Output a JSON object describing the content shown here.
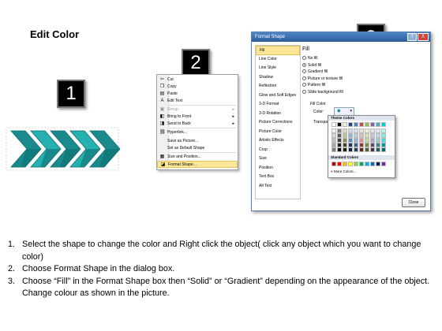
{
  "slide_title": "Edit Color",
  "badges": [
    "1",
    "2",
    "3"
  ],
  "context_menu": {
    "items": [
      {
        "icon": "cut-icon",
        "glyph": "✂",
        "label": "Cut",
        "disabled": false,
        "submenu": false
      },
      {
        "icon": "copy-icon",
        "glyph": "❐",
        "label": "Copy",
        "disabled": false,
        "submenu": false
      },
      {
        "icon": "paste-icon",
        "glyph": "▤",
        "label": "Paste",
        "disabled": false,
        "submenu": false
      },
      {
        "icon": "edit-text-icon",
        "glyph": "A",
        "label": "Edit Text",
        "disabled": false,
        "submenu": false
      },
      {
        "icon": "group-icon",
        "glyph": "▣",
        "label": "Group",
        "disabled": true,
        "submenu": true
      },
      {
        "icon": "bring-front-icon",
        "glyph": "◧",
        "label": "Bring to Front",
        "disabled": false,
        "submenu": true
      },
      {
        "icon": "send-back-icon",
        "glyph": "◨",
        "label": "Send to Back",
        "disabled": false,
        "submenu": true
      },
      {
        "icon": "hyperlink-icon",
        "glyph": "⛓",
        "label": "Hyperlink...",
        "disabled": false,
        "submenu": false
      },
      {
        "icon": "save-picture-icon",
        "glyph": "",
        "label": "Save as Picture...",
        "disabled": false,
        "submenu": false
      },
      {
        "icon": "default-shape-icon",
        "glyph": "",
        "label": "Set as Default Shape",
        "disabled": false,
        "submenu": false
      },
      {
        "icon": "size-position-icon",
        "glyph": "▦",
        "label": "Size and Position...",
        "disabled": false,
        "submenu": false
      },
      {
        "icon": "format-shape-icon",
        "glyph": "◪",
        "label": "Format Shape...",
        "disabled": false,
        "submenu": false,
        "highlight": true
      }
    ]
  },
  "dialog": {
    "title": "Format Shape",
    "help_label": "?",
    "close_x_label": "X",
    "categories": [
      "Fill",
      "Line Color",
      "Line Style",
      "Shadow",
      "Reflection",
      "Glow and Soft Edges",
      "3-D Format",
      "3-D Rotation",
      "Picture Corrections",
      "Picture Color",
      "Artistic Effects",
      "Crop",
      "Size",
      "Position",
      "Text Box",
      "Alt Text"
    ],
    "selected_category": "Fill",
    "fill_heading": "Fill",
    "fill_options": [
      "No fill",
      "Solid fill",
      "Gradient fill",
      "Picture or texture fill",
      "Pattern fill",
      "Slide background fill"
    ],
    "selected_fill": "Solid fill",
    "fill_color_label": "Fill Color",
    "color_label": "Color:",
    "transparency_label": "Transpar",
    "close_button": "Close"
  },
  "palette": {
    "theme_heading": "Theme Colors",
    "standard_heading": "Standard Colors",
    "more_colors": "More Colors...",
    "theme_top": [
      "#ffffff",
      "#000000",
      "#eeece1",
      "#1f497d",
      "#4f81bd",
      "#c0504d",
      "#9bbb59",
      "#8064a2",
      "#4bacc6",
      "#00d0d0"
    ],
    "theme_shades": [
      [
        "#f2f2f2",
        "#7f7f7f",
        "#ddd9c3",
        "#c6d9f0",
        "#dbe5f1",
        "#f2dcdb",
        "#ebf1dd",
        "#e5e0ec",
        "#dbeef3",
        "#b3f5f5"
      ],
      [
        "#d8d8d8",
        "#595959",
        "#c4bd97",
        "#8db3e2",
        "#b8cce4",
        "#e5b9b7",
        "#d7e3bc",
        "#ccc1d9",
        "#b7dde8",
        "#80eded"
      ],
      [
        "#bfbfbf",
        "#3f3f3f",
        "#938953",
        "#548dd4",
        "#95b3d7",
        "#d99694",
        "#c3d69b",
        "#b2a2c7",
        "#92cddc",
        "#40e0e0"
      ],
      [
        "#a5a5a5",
        "#262626",
        "#494429",
        "#17365d",
        "#366092",
        "#953734",
        "#76923c",
        "#5f497a",
        "#31859b",
        "#009c9c"
      ],
      [
        "#7f7f7f",
        "#0c0c0c",
        "#1d1b10",
        "#0f243e",
        "#244061",
        "#632423",
        "#4f6128",
        "#3f3151",
        "#205867",
        "#006868"
      ]
    ],
    "standard": [
      "#c00000",
      "#ff0000",
      "#ffc000",
      "#ffff00",
      "#92d050",
      "#00b050",
      "#00b0f0",
      "#0070c0",
      "#002060",
      "#7030a0"
    ]
  },
  "arrows": {
    "colors": [
      "#1a8a8c",
      "#26b0b0",
      "#0f6f72"
    ]
  },
  "steps": [
    {
      "num": "1.",
      "text": "Select the shape to change the color and Right click the object( click any object which you want to change color)"
    },
    {
      "num": "2.",
      "text": "Choose Format Shape in the dialog box."
    },
    {
      "num": "3.",
      "text": "Choose “Fill” in the Format Shape box then “Solid” or “Gradient” depending on the appearance of the object. Change colour as shown in the picture."
    }
  ]
}
